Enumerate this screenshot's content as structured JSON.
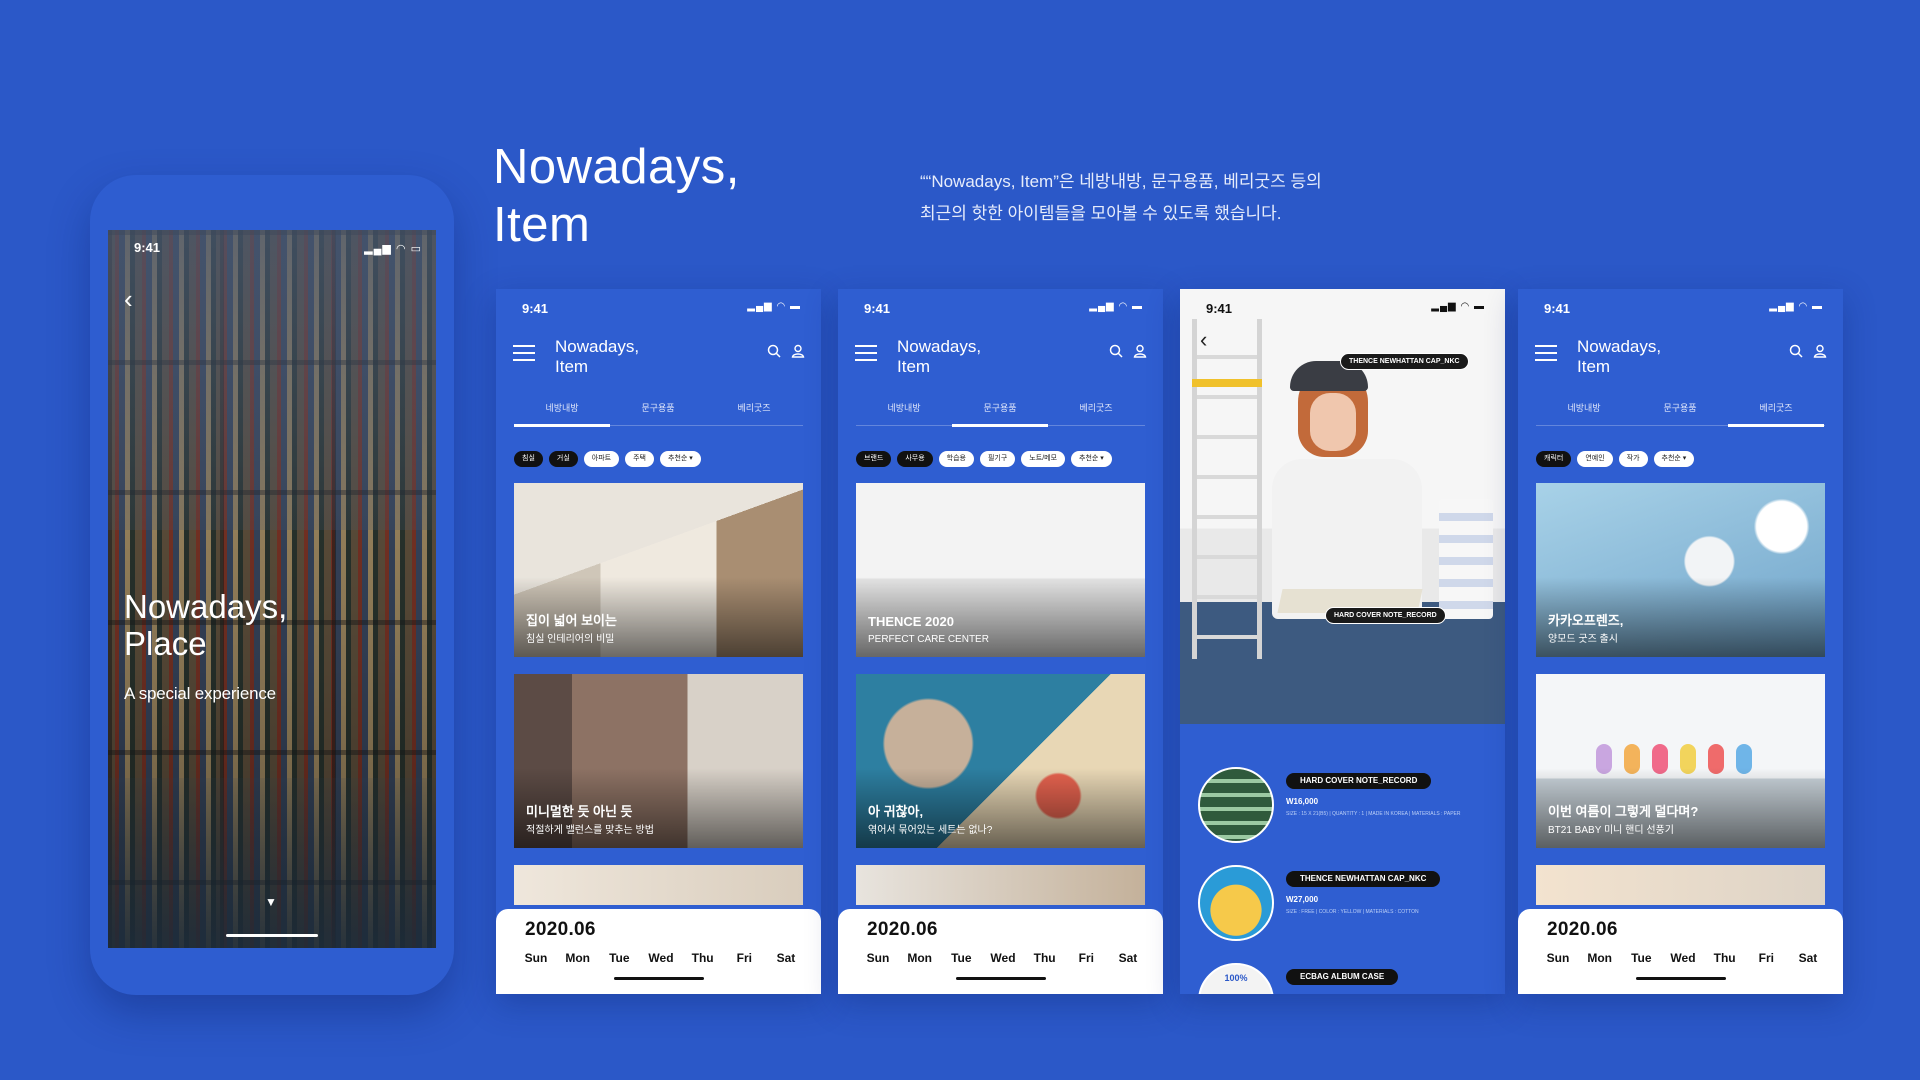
{
  "header": {
    "headline": [
      "Nowadays,",
      "Item"
    ],
    "description": [
      "““Nowadays, Item”은 네방내방, 문구용품, 베리굿즈 등의",
      "최근의 핫한 아이템들을 모아볼 수 있도록 했습니다."
    ]
  },
  "hero": {
    "time": "9:41",
    "back_icon": "chevron-left-icon",
    "title": [
      "Nowadays,",
      "Place"
    ],
    "subtitle": "A special experience",
    "scroll_icon": "triangle-down-icon"
  },
  "common": {
    "time": "9:41",
    "app_title": [
      "Nowadays,",
      "Item"
    ],
    "tabs": [
      "네방내방",
      "문구용품",
      "베리굿즈"
    ],
    "calendar": {
      "month": "2020.06",
      "days": [
        "Sun",
        "Mon",
        "Tue",
        "Wed",
        "Thu",
        "Fri",
        "Sat"
      ]
    }
  },
  "phone1": {
    "active_tab": 0,
    "chips": [
      "침실",
      "거실",
      "아파트",
      "주택",
      "추천순 ▾"
    ],
    "cards": [
      {
        "title": "집이 넓어 보이는",
        "subtitle": "침실 인테리어의 비밀"
      },
      {
        "title": "미니멀한 듯 아닌 듯",
        "subtitle": "적절하게 밸런스를 맞추는 방법"
      }
    ]
  },
  "phone2": {
    "active_tab": 1,
    "chips": [
      "브랜드",
      "사무용",
      "학습용",
      "필기구",
      "노트/메모",
      "추천순 ▾"
    ],
    "cards": [
      {
        "title": "THENCE 2020",
        "subtitle": "PERFECT CARE CENTER"
      },
      {
        "title": "아 귀찮아,",
        "subtitle": "엮어서 묶어있는 세트는 없나?"
      }
    ]
  },
  "phone3": {
    "time": "9:41",
    "tags": [
      "THENCE NEWHATTAN CAP_NKC",
      "HARD COVER NOTE_RECORD"
    ],
    "products": [
      {
        "name": "HARD COVER NOTE_RECORD",
        "price": "W16,000",
        "meta": "SIZE : 15 X 21(B5) | QUANTITY : 1 | MADE IN KOREA | MATERIALS : PAPER"
      },
      {
        "name": "THENCE NEWHATTAN CAP_NKC",
        "price": "W27,000",
        "meta": "SIZE : FREE | COLOR : YELLOW | MATERIALS : COTTON"
      },
      {
        "name": "ECBAG ALBUM CASE",
        "price": "",
        "meta": ""
      }
    ],
    "badge": "100%"
  },
  "phone4": {
    "active_tab": 2,
    "chips": [
      "캐릭터",
      "연예인",
      "작가",
      "추천순 ▾"
    ],
    "cards": [
      {
        "title": "카카오프렌즈,",
        "subtitle": "양모드 굿즈 출시"
      },
      {
        "title": "이번 여름이 그렇게 덜다며?",
        "subtitle": "BT21 BABY 미니 핸디 선풍기"
      }
    ]
  },
  "colors": {
    "background": "#2B58C8",
    "phone": "#2F5ED1",
    "accent_text": "#FFFFFF"
  }
}
